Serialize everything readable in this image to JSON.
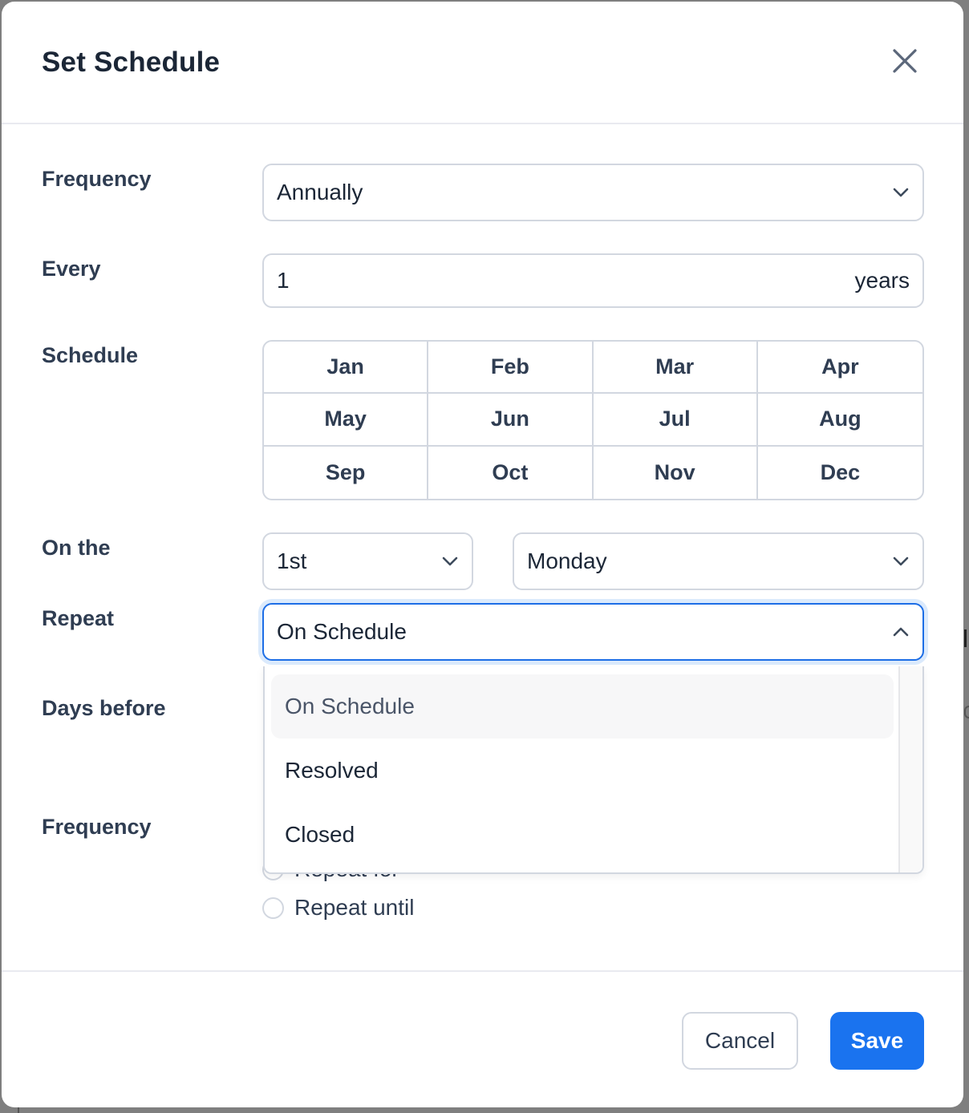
{
  "modal": {
    "title": "Set Schedule",
    "close_icon": "close-icon"
  },
  "form": {
    "frequency": {
      "label": "Frequency",
      "value": "Annually",
      "icon": "chevron-down-icon"
    },
    "every": {
      "label": "Every",
      "value": "1",
      "suffix": "years"
    },
    "schedule": {
      "label": "Schedule",
      "months": [
        "Jan",
        "Feb",
        "Mar",
        "Apr",
        "May",
        "Jun",
        "Jul",
        "Aug",
        "Sep",
        "Oct",
        "Nov",
        "Dec"
      ]
    },
    "on_the": {
      "label": "On the",
      "ordinal": "1st",
      "weekday": "Monday"
    },
    "repeat": {
      "label": "Repeat",
      "value": "On Schedule",
      "icon": "chevron-up-icon",
      "open": true,
      "options": [
        "On Schedule",
        "Resolved",
        "Closed"
      ],
      "highlighted_option": "On Schedule"
    },
    "days_before": {
      "label": "Days before"
    },
    "end_frequency": {
      "label": "Frequency",
      "options": [
        "Repeat for",
        "Repeat until"
      ]
    }
  },
  "footer": {
    "cancel_label": "Cancel",
    "save_label": "Save"
  },
  "colors": {
    "primary": "#1a73ef",
    "focus_ring": "#dbeafc",
    "border": "#d2d7e0",
    "text": "#1b2636",
    "label": "#2f3d52",
    "backdrop": "#7f7f7f"
  }
}
